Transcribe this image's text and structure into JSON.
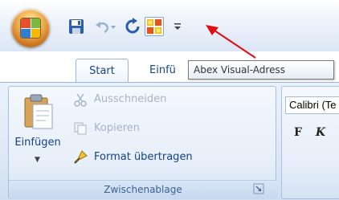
{
  "tooltip": {
    "text": "Abex Visual-Adress"
  },
  "tabs": [
    {
      "label": "Start"
    },
    {
      "label": "Einfü"
    }
  ],
  "quick_access": {
    "icons": [
      "save-icon",
      "undo-icon",
      "redo-icon",
      "abex-visual-adress-icon",
      "customize-qat-icon"
    ]
  },
  "clipboard_group": {
    "title": "Zwischenablage",
    "paste_label": "Einfügen",
    "cut_label": "Ausschneiden",
    "copy_label": "Kopieren",
    "format_painter_label": "Format übertragen"
  },
  "font_group": {
    "font_name": "Calibri (Te",
    "bold_label": "F",
    "italic_label": "K"
  },
  "colors": {
    "annotation_arrow": "#e01010",
    "ribbon_text": "#15428b",
    "disabled_text": "#a6b4c8"
  }
}
